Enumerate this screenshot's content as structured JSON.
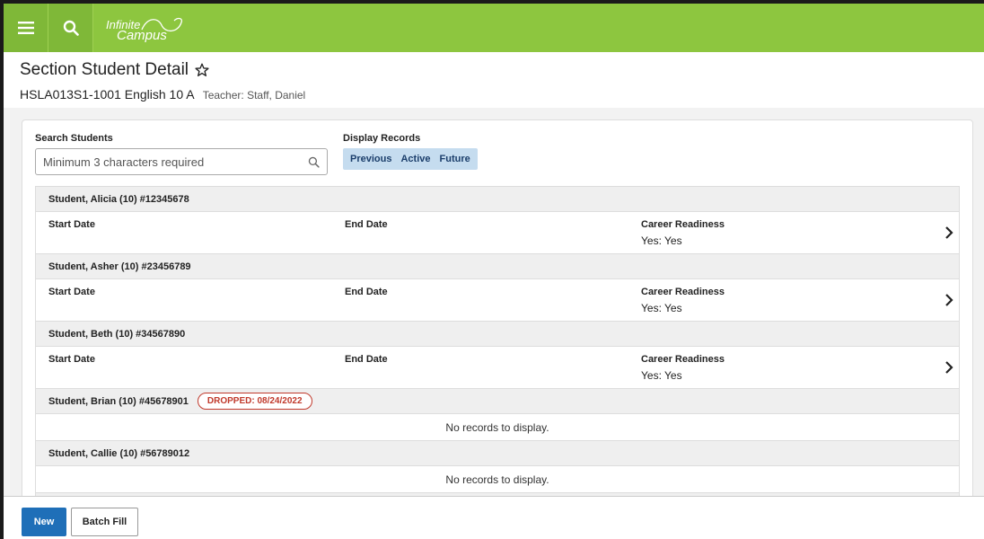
{
  "app": {
    "logo_line1": "Infinite",
    "logo_line2": "Campus"
  },
  "page": {
    "title": "Section Student Detail",
    "section": "HSLA013S1-1001 English 10 A",
    "teacher": "Teacher: Staff, Daniel"
  },
  "search": {
    "label": "Search Students",
    "placeholder": "Minimum 3 characters required"
  },
  "display_records": {
    "label": "Display Records",
    "options": [
      "Previous",
      "Active",
      "Future"
    ]
  },
  "columns": {
    "start": "Start Date",
    "end": "End Date",
    "career": "Career Readiness"
  },
  "students": [
    {
      "name": "Student, Alicia (10) #12345678",
      "career_value": "Yes: Yes"
    },
    {
      "name": "Student, Asher (10) #23456789",
      "career_value": "Yes: Yes"
    },
    {
      "name": "Student, Beth (10) #34567890",
      "career_value": "Yes: Yes"
    },
    {
      "name": "Student, Brian (10) #45678901",
      "badge": "DROPPED: 08/24/2022",
      "empty": "No records to display."
    },
    {
      "name": "Student, Callie (10) #56789012",
      "empty": "No records to display."
    }
  ],
  "footer": {
    "new_label": "New",
    "batch_label": "Batch Fill"
  },
  "colors": {
    "brand_green": "#8dc63f",
    "primary_blue": "#1f6fb8",
    "dropped_red": "#c0392b"
  }
}
